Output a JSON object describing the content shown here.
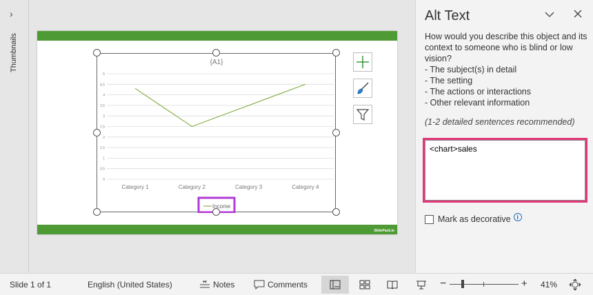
{
  "thumbnails": {
    "label": "Thumbnails",
    "chevron": "›"
  },
  "slide": {
    "brand": "SlidePack.io"
  },
  "chart_data": {
    "type": "line",
    "title": "{A1}",
    "categories": [
      "Category 1",
      "Category 2",
      "Category 3",
      "Category 4"
    ],
    "series": [
      {
        "name": "Income",
        "values": [
          4.3,
          2.5,
          3.5,
          4.5
        ],
        "color": "#8ab04a"
      }
    ],
    "yticks": [
      "5",
      "4,5",
      "4",
      "3,5",
      "3",
      "2,5",
      "2",
      "1,5",
      "1",
      "0,5",
      "0"
    ],
    "ylim": [
      0,
      5
    ],
    "grid": true,
    "legend": "bottom"
  },
  "chart_tools": [
    "plus-icon",
    "brush-icon",
    "filter-icon"
  ],
  "alt_pane": {
    "title": "Alt Text",
    "description_lines": [
      "How would you describe this object and its",
      "context to someone who is blind or low",
      "vision?",
      "- The subject(s) in detail",
      "- The setting",
      "- The actions or interactions",
      "- Other relevant information"
    ],
    "hint": "(1-2 detailed sentences recommended)",
    "alt_text_value": "<chart>sales",
    "decorative_label": "Mark as decorative",
    "highlight_color": "#e2387a"
  },
  "status_bar": {
    "slide_info": "Slide 1 of 1",
    "language": "English (United States)",
    "notes_label": "Notes",
    "comments_label": "Comments",
    "zoom": "41%"
  },
  "colors": {
    "accent_green": "#4e9a35",
    "legend_highlight": "#b23ad6"
  }
}
